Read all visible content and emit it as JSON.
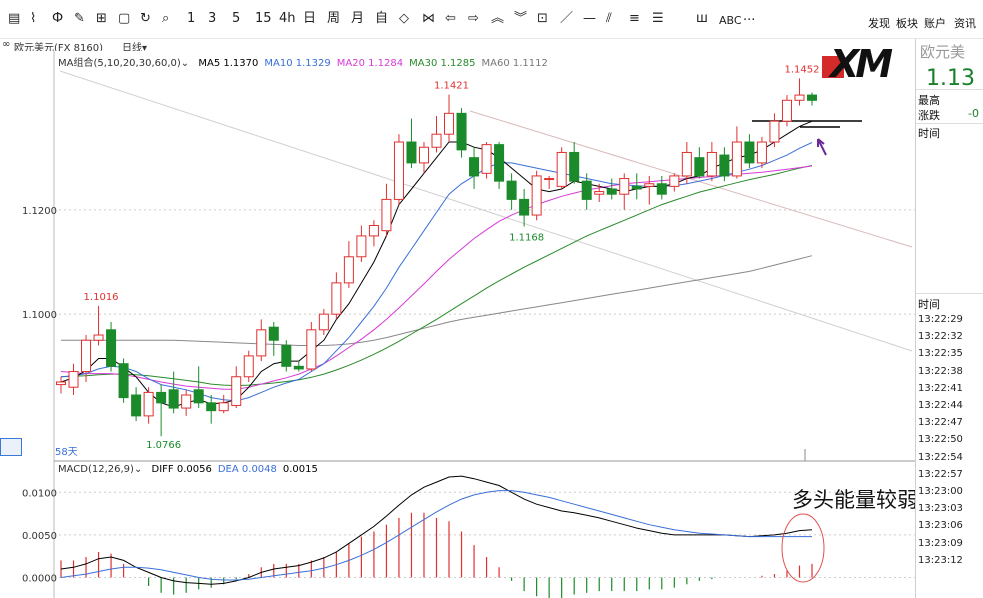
{
  "toolbar": {
    "icons": [
      {
        "name": "menu-grid-icon",
        "glyph": "▤"
      },
      {
        "name": "line-chart-icon",
        "glyph": "⌇"
      },
      {
        "name": "candle-icon",
        "glyph": "Ф"
      },
      {
        "name": "edit-chart-icon",
        "glyph": "✎"
      },
      {
        "name": "layout-icon",
        "glyph": "⊞"
      },
      {
        "name": "save-icon",
        "glyph": "▢"
      },
      {
        "name": "refresh-icon",
        "glyph": "↻"
      },
      {
        "name": "zoom-icon",
        "glyph": "⌕"
      }
    ],
    "periods": [
      "1",
      "3",
      "5",
      "15",
      "4h",
      "日",
      "周",
      "月",
      "自"
    ],
    "tools": [
      {
        "name": "draw-ellipse-icon",
        "glyph": "◇"
      },
      {
        "name": "bowtie-icon",
        "glyph": "⋈"
      },
      {
        "name": "arrow-left-icon",
        "glyph": "⇦"
      },
      {
        "name": "arrow-right-icon",
        "glyph": "⇨"
      },
      {
        "name": "chevron-up-icon",
        "glyph": "︽"
      },
      {
        "name": "chevron-down-icon",
        "glyph": "︾"
      },
      {
        "name": "crosshair-icon",
        "glyph": "⊡"
      },
      {
        "name": "line-tool-icon",
        "glyph": "／"
      },
      {
        "name": "hline-tool-icon",
        "glyph": "—"
      },
      {
        "name": "parallel-tool-icon",
        "glyph": "⫽"
      },
      {
        "name": "fib-icon",
        "glyph": "≡"
      },
      {
        "name": "channel-icon",
        "glyph": "☰"
      },
      {
        "name": "volume-bars-icon",
        "glyph": "ш"
      }
    ],
    "abc": "ABC",
    "more": "···",
    "menu": [
      "发现",
      "板块",
      "账户",
      "资讯"
    ]
  },
  "symbol_bar": {
    "icon": "∞",
    "symbol": "欧元美元(FX 8160)",
    "period": "日线"
  },
  "ma_legend": {
    "group": "MA组合(5,10,20,30,60,0)",
    "items": [
      {
        "label": "MA5 1.1370",
        "color": "#000000"
      },
      {
        "label": "MA10 1.1329",
        "color": "#3a6fd8"
      },
      {
        "label": "MA20 1.1284",
        "color": "#d63ad6"
      },
      {
        "label": "MA30 1.1285",
        "color": "#2a8a2a"
      },
      {
        "label": "MA60 1.1112",
        "color": "#777777"
      }
    ]
  },
  "macd_legend": {
    "group": "MACD(12,26,9)",
    "items": [
      {
        "label": "DIFF 0.0056",
        "color": "#000000"
      },
      {
        "label": "DEA 0.0048",
        "color": "#3a6fd8"
      },
      {
        "label": "0.0015",
        "color": "#000000"
      }
    ]
  },
  "price_axis": [
    "1.1200",
    "1.1000"
  ],
  "macd_axis": [
    "0.0100",
    "0.0050",
    "0.0000"
  ],
  "price_labels": {
    "high": "1.1421",
    "recent_high": "1.1452",
    "low": "1.1168",
    "left_high": "1.1016",
    "left_low": "1.0766",
    "days": "58天"
  },
  "annotation": "多头能量较弱",
  "right_panel": {
    "title": "欧元美",
    "price": "1.13",
    "high_label": "最高",
    "change_label": "涨跌",
    "change_value": "-0",
    "time_header": "时间",
    "time_header2": "时间",
    "times": [
      "13:22:29",
      "13:22:32",
      "13:22:35",
      "13:22:38",
      "13:22:41",
      "13:22:44",
      "13:22:47",
      "13:22:50",
      "13:22:54",
      "13:22:57",
      "13:23:00",
      "13:23:03",
      "13:23:06",
      "13:23:09",
      "13:23:12"
    ]
  },
  "logo_text": "XM",
  "colors": {
    "up": "#e03030",
    "down": "#1a8a2a",
    "accent": "#3a6fd8"
  },
  "chart_data": {
    "type": "candlestick",
    "candles": [
      [
        1.0865,
        1.087,
        1.0848,
        1.088
      ],
      [
        1.086,
        1.089,
        1.0845,
        1.0905
      ],
      [
        1.089,
        1.095,
        1.087,
        1.096
      ],
      [
        1.095,
        1.096,
        1.094,
        1.1016
      ],
      [
        1.097,
        1.09,
        1.089,
        1.0985
      ],
      [
        1.0905,
        1.084,
        1.083,
        1.0915
      ],
      [
        1.0845,
        1.0805,
        1.0795,
        1.086
      ],
      [
        1.0805,
        1.085,
        1.079,
        1.086
      ],
      [
        1.085,
        1.083,
        1.0766,
        1.0865
      ],
      [
        1.0855,
        1.082,
        1.081,
        1.089
      ],
      [
        1.082,
        1.0845,
        1.0805,
        1.0855
      ],
      [
        1.0855,
        1.083,
        1.082,
        1.09
      ],
      [
        1.083,
        1.0815,
        1.079,
        1.0845
      ],
      [
        1.0815,
        1.083,
        1.081,
        1.0845
      ],
      [
        1.0825,
        1.088,
        1.082,
        1.09
      ],
      [
        1.088,
        1.092,
        1.087,
        1.093
      ],
      [
        1.092,
        1.097,
        1.091,
        1.099
      ],
      [
        1.0975,
        1.095,
        1.092,
        1.0985
      ],
      [
        1.094,
        1.09,
        1.089,
        1.095
      ],
      [
        1.09,
        1.0895,
        1.089,
        1.091
      ],
      [
        1.0895,
        1.097,
        1.089,
        1.0985
      ],
      [
        1.097,
        1.1,
        1.096,
        1.101
      ],
      [
        1.1,
        1.106,
        1.099,
        1.108
      ],
      [
        1.106,
        1.111,
        1.105,
        1.114
      ],
      [
        1.111,
        1.115,
        1.11,
        1.117
      ],
      [
        1.115,
        1.117,
        1.113,
        1.118
      ],
      [
        1.116,
        1.122,
        1.115,
        1.125
      ],
      [
        1.122,
        1.133,
        1.121,
        1.1345
      ],
      [
        1.133,
        1.129,
        1.128,
        1.1375
      ],
      [
        1.129,
        1.132,
        1.127,
        1.133
      ],
      [
        1.132,
        1.1345,
        1.131,
        1.138
      ],
      [
        1.1345,
        1.1385,
        1.133,
        1.1421
      ],
      [
        1.1385,
        1.1315,
        1.13,
        1.1395
      ],
      [
        1.13,
        1.1265,
        1.124,
        1.132
      ],
      [
        1.127,
        1.1325,
        1.126,
        1.133
      ],
      [
        1.1325,
        1.1255,
        1.124,
        1.133
      ],
      [
        1.1255,
        1.122,
        1.12,
        1.127
      ],
      [
        1.122,
        1.119,
        1.1168,
        1.124
      ],
      [
        1.119,
        1.1265,
        1.118,
        1.1275
      ],
      [
        1.126,
        1.126,
        1.124,
        1.1265
      ],
      [
        1.1245,
        1.131,
        1.124,
        1.132
      ],
      [
        1.131,
        1.1255,
        1.125,
        1.133
      ],
      [
        1.1255,
        1.122,
        1.12,
        1.127
      ],
      [
        1.123,
        1.1235,
        1.1215,
        1.125
      ],
      [
        1.124,
        1.123,
        1.122,
        1.126
      ],
      [
        1.123,
        1.126,
        1.12,
        1.127
      ],
      [
        1.1245,
        1.124,
        1.122,
        1.127
      ],
      [
        1.1245,
        1.125,
        1.121,
        1.1265
      ],
      [
        1.125,
        1.123,
        1.122,
        1.1265
      ],
      [
        1.1245,
        1.1265,
        1.1235,
        1.127
      ],
      [
        1.1265,
        1.131,
        1.125,
        1.133
      ],
      [
        1.13,
        1.1265,
        1.126,
        1.132
      ],
      [
        1.1265,
        1.131,
        1.1255,
        1.133
      ],
      [
        1.1305,
        1.1265,
        1.1255,
        1.132
      ],
      [
        1.1265,
        1.133,
        1.126,
        1.136
      ],
      [
        1.133,
        1.129,
        1.128,
        1.1345
      ],
      [
        1.129,
        1.133,
        1.128,
        1.134
      ],
      [
        1.133,
        1.137,
        1.132,
        1.1385
      ],
      [
        1.137,
        1.141,
        1.136,
        1.142
      ],
      [
        1.141,
        1.142,
        1.14,
        1.1452
      ],
      [
        1.142,
        1.141,
        1.14,
        1.1425
      ]
    ],
    "price_range": [
      1.073,
      1.147
    ],
    "macd_range": [
      -0.001,
      0.0125
    ],
    "ma5": [
      1.087,
      1.0878,
      1.0892,
      1.0915,
      1.0915,
      1.0898,
      1.088,
      1.085,
      1.083,
      1.0822,
      1.083,
      1.0836,
      1.0828,
      1.083,
      1.0836,
      1.086,
      1.089,
      1.0905,
      1.091,
      1.091,
      1.093,
      1.095,
      1.099,
      1.102,
      1.106,
      1.11,
      1.115,
      1.121,
      1.124,
      1.127,
      1.13,
      1.133,
      1.133,
      1.132,
      1.1315,
      1.13,
      1.128,
      1.126,
      1.124,
      1.1235,
      1.124,
      1.1255,
      1.125,
      1.1245,
      1.124,
      1.1235,
      1.124,
      1.1245,
      1.1245,
      1.125,
      1.126,
      1.1265,
      1.128,
      1.129,
      1.13,
      1.1305,
      1.1315,
      1.133,
      1.1345,
      1.136,
      1.137
    ],
    "ma10": [
      1.088,
      1.0882,
      1.0886,
      1.0895,
      1.09,
      1.0898,
      1.089,
      1.0876,
      1.0865,
      1.086,
      1.0855,
      1.0848,
      1.084,
      1.0836,
      1.0834,
      1.084,
      1.085,
      1.086,
      1.0868,
      1.0875,
      1.089,
      1.0905,
      1.093,
      1.0955,
      1.0985,
      1.1015,
      1.105,
      1.109,
      1.1125,
      1.116,
      1.1195,
      1.123,
      1.125,
      1.1265,
      1.128,
      1.129,
      1.129,
      1.1285,
      1.128,
      1.1275,
      1.127,
      1.1265,
      1.126,
      1.1255,
      1.125,
      1.1248,
      1.1246,
      1.1245,
      1.1245,
      1.1246,
      1.125,
      1.1255,
      1.126,
      1.1266,
      1.1272,
      1.1278,
      1.1285,
      1.1295,
      1.1305,
      1.1318,
      1.1329
    ],
    "ma20": [
      1.089,
      1.0888,
      1.0886,
      1.0886,
      1.0886,
      1.0884,
      1.088,
      1.0875,
      1.087,
      1.0866,
      1.0862,
      1.086,
      1.0858,
      1.0856,
      1.0856,
      1.086,
      1.0866,
      1.0872,
      1.0878,
      1.0885,
      1.0895,
      1.0905,
      1.092,
      1.0936,
      1.0952,
      1.097,
      1.099,
      1.1012,
      1.1035,
      1.1058,
      1.1082,
      1.1105,
      1.1125,
      1.1145,
      1.1162,
      1.1178,
      1.119,
      1.12,
      1.121,
      1.1218,
      1.1226,
      1.1232,
      1.1238,
      1.1242,
      1.1246,
      1.125,
      1.1252,
      1.1254,
      1.1256,
      1.1258,
      1.126,
      1.1262,
      1.1264,
      1.1266,
      1.1268,
      1.127,
      1.1272,
      1.1275,
      1.1278,
      1.1281,
      1.1284
    ],
    "ma30": [
      1.088,
      1.0881,
      1.0882,
      1.0884,
      1.0885,
      1.0885,
      1.0884,
      1.0882,
      1.0879,
      1.0876,
      1.0873,
      1.087,
      1.0866,
      1.0864,
      1.0863,
      1.0864,
      1.0866,
      1.0868,
      1.0871,
      1.0874,
      1.0879,
      1.0885,
      1.0893,
      1.0902,
      1.0912,
      1.0923,
      1.0935,
      1.0948,
      1.0962,
      1.0976,
      1.099,
      1.1005,
      1.102,
      1.1035,
      1.105,
      1.1064,
      1.1077,
      1.109,
      1.1102,
      1.1114,
      1.1126,
      1.1138,
      1.115,
      1.116,
      1.117,
      1.118,
      1.119,
      1.12,
      1.121,
      1.1218,
      1.1226,
      1.1234,
      1.124,
      1.1246,
      1.1252,
      1.1258,
      1.1263,
      1.1268,
      1.1274,
      1.128,
      1.1285
    ],
    "ma60": [
      1.095,
      1.095,
      1.095,
      1.095,
      1.095,
      1.095,
      1.095,
      1.095,
      1.095,
      1.095,
      1.0949,
      1.0948,
      1.0947,
      1.0946,
      1.0945,
      1.0944,
      1.0943,
      1.0942,
      1.0941,
      1.094,
      1.094,
      1.094,
      1.0941,
      1.0943,
      1.0946,
      1.095,
      1.0955,
      1.0961,
      1.0967,
      1.0973,
      1.0979,
      1.0985,
      1.099,
      1.0994,
      1.0998,
      1.1002,
      1.1006,
      1.101,
      1.1014,
      1.1018,
      1.1022,
      1.1026,
      1.103,
      1.1034,
      1.1038,
      1.1042,
      1.1046,
      1.105,
      1.1054,
      1.1058,
      1.1062,
      1.1066,
      1.107,
      1.1074,
      1.1078,
      1.1082,
      1.1088,
      1.1094,
      1.11,
      1.1106,
      1.1112
    ],
    "diff": [
      0.001,
      0.0012,
      0.0016,
      0.0022,
      0.0024,
      0.002,
      0.0012,
      0.0006,
      0.0,
      -0.0004,
      -0.0006,
      -0.0007,
      -0.0008,
      -0.0007,
      -0.0004,
      0.0,
      0.0006,
      0.001,
      0.0012,
      0.0014,
      0.0018,
      0.0023,
      0.003,
      0.004,
      0.005,
      0.006,
      0.0072,
      0.0085,
      0.0097,
      0.0106,
      0.0112,
      0.0118,
      0.0119,
      0.0116,
      0.0112,
      0.0108,
      0.01,
      0.0092,
      0.0086,
      0.0082,
      0.0078,
      0.0076,
      0.0073,
      0.007,
      0.0066,
      0.0062,
      0.0058,
      0.0055,
      0.0052,
      0.005,
      0.005,
      0.005,
      0.005,
      0.005,
      0.0049,
      0.0048,
      0.0049,
      0.005,
      0.0052,
      0.0055,
      0.0056
    ],
    "dea": [
      0.0,
      0.0002,
      0.0004,
      0.0007,
      0.001,
      0.0012,
      0.0012,
      0.0011,
      0.0009,
      0.0006,
      0.0003,
      0.0,
      -0.0002,
      -0.0003,
      -0.0003,
      -0.0002,
      0.0,
      0.0002,
      0.0004,
      0.0006,
      0.0008,
      0.0011,
      0.0015,
      0.002,
      0.0026,
      0.0033,
      0.0041,
      0.005,
      0.0059,
      0.0068,
      0.0077,
      0.0085,
      0.0092,
      0.0097,
      0.01,
      0.0102,
      0.0102,
      0.01,
      0.0097,
      0.0094,
      0.009,
      0.0086,
      0.0082,
      0.0078,
      0.0074,
      0.007,
      0.0066,
      0.0062,
      0.0059,
      0.0056,
      0.0054,
      0.0052,
      0.0051,
      0.005,
      0.0049,
      0.0048,
      0.0048,
      0.0048,
      0.0048,
      0.0048,
      0.0048
    ],
    "title": "",
    "xlabel": "",
    "ylabel": ""
  }
}
